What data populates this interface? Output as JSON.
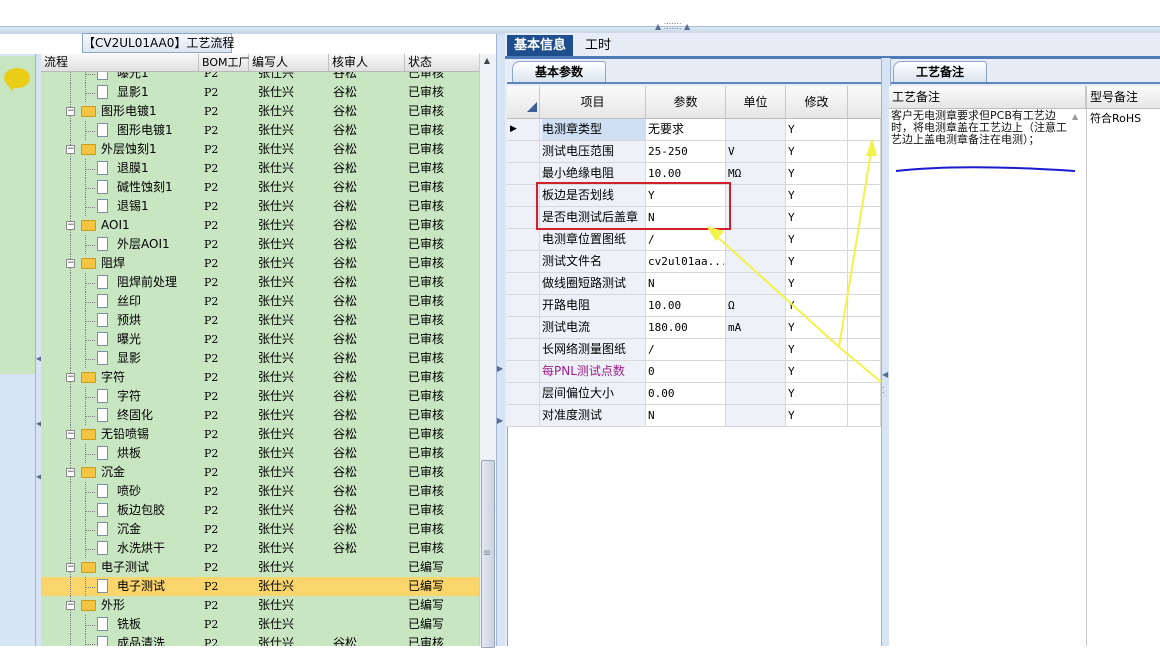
{
  "process_panel": {
    "title": "【CV2UL01AA0】工艺流程",
    "columns": [
      "流程",
      "BOM工厂",
      "编写人",
      "核审人",
      "状态"
    ],
    "rows": [
      {
        "name": "曝光1",
        "level": 2,
        "icon": "doc",
        "bom": "P2",
        "writer": "张仕兴",
        "reviewer": "谷松",
        "status": "已审核",
        "cut": true
      },
      {
        "name": "显影1",
        "level": 2,
        "icon": "doc",
        "bom": "P2",
        "writer": "张仕兴",
        "reviewer": "谷松",
        "status": "已审核"
      },
      {
        "name": "图形电镀1",
        "level": 1,
        "icon": "folder",
        "bom": "P2",
        "writer": "张仕兴",
        "reviewer": "谷松",
        "status": "已审核"
      },
      {
        "name": "图形电镀1",
        "level": 2,
        "icon": "doc",
        "bom": "P2",
        "writer": "张仕兴",
        "reviewer": "谷松",
        "status": "已审核"
      },
      {
        "name": "外层蚀刻1",
        "level": 1,
        "icon": "folder",
        "bom": "P2",
        "writer": "张仕兴",
        "reviewer": "谷松",
        "status": "已审核"
      },
      {
        "name": "退膜1",
        "level": 2,
        "icon": "doc",
        "bom": "P2",
        "writer": "张仕兴",
        "reviewer": "谷松",
        "status": "已审核"
      },
      {
        "name": "碱性蚀刻1",
        "level": 2,
        "icon": "doc",
        "bom": "P2",
        "writer": "张仕兴",
        "reviewer": "谷松",
        "status": "已审核"
      },
      {
        "name": "退锡1",
        "level": 2,
        "icon": "doc",
        "bom": "P2",
        "writer": "张仕兴",
        "reviewer": "谷松",
        "status": "已审核"
      },
      {
        "name": "AOI1",
        "level": 1,
        "icon": "folder",
        "bom": "P2",
        "writer": "张仕兴",
        "reviewer": "谷松",
        "status": "已审核"
      },
      {
        "name": "外层AOI1",
        "level": 2,
        "icon": "doc",
        "bom": "P2",
        "writer": "张仕兴",
        "reviewer": "谷松",
        "status": "已审核"
      },
      {
        "name": "阻焊",
        "level": 1,
        "icon": "folder",
        "bom": "P2",
        "writer": "张仕兴",
        "reviewer": "谷松",
        "status": "已审核"
      },
      {
        "name": "阻焊前处理",
        "level": 2,
        "icon": "doc",
        "bom": "P2",
        "writer": "张仕兴",
        "reviewer": "谷松",
        "status": "已审核"
      },
      {
        "name": "丝印",
        "level": 2,
        "icon": "doc",
        "bom": "P2",
        "writer": "张仕兴",
        "reviewer": "谷松",
        "status": "已审核"
      },
      {
        "name": "预烘",
        "level": 2,
        "icon": "doc",
        "bom": "P2",
        "writer": "张仕兴",
        "reviewer": "谷松",
        "status": "已审核"
      },
      {
        "name": "曝光",
        "level": 2,
        "icon": "doc",
        "bom": "P2",
        "writer": "张仕兴",
        "reviewer": "谷松",
        "status": "已审核"
      },
      {
        "name": "显影",
        "level": 2,
        "icon": "doc",
        "bom": "P2",
        "writer": "张仕兴",
        "reviewer": "谷松",
        "status": "已审核"
      },
      {
        "name": "字符",
        "level": 1,
        "icon": "folder",
        "bom": "P2",
        "writer": "张仕兴",
        "reviewer": "谷松",
        "status": "已审核"
      },
      {
        "name": "字符",
        "level": 2,
        "icon": "doc",
        "bom": "P2",
        "writer": "张仕兴",
        "reviewer": "谷松",
        "status": "已审核"
      },
      {
        "name": "终固化",
        "level": 2,
        "icon": "doc",
        "bom": "P2",
        "writer": "张仕兴",
        "reviewer": "谷松",
        "status": "已审核"
      },
      {
        "name": "无铅喷锡",
        "level": 1,
        "icon": "folder",
        "bom": "P2",
        "writer": "张仕兴",
        "reviewer": "谷松",
        "status": "已审核"
      },
      {
        "name": "烘板",
        "level": 2,
        "icon": "doc",
        "bom": "P2",
        "writer": "张仕兴",
        "reviewer": "谷松",
        "status": "已审核"
      },
      {
        "name": "沉金",
        "level": 1,
        "icon": "folder",
        "bom": "P2",
        "writer": "张仕兴",
        "reviewer": "谷松",
        "status": "已审核"
      },
      {
        "name": "喷砂",
        "level": 2,
        "icon": "doc",
        "bom": "P2",
        "writer": "张仕兴",
        "reviewer": "谷松",
        "status": "已审核"
      },
      {
        "name": "板边包胶",
        "level": 2,
        "icon": "doc",
        "bom": "P2",
        "writer": "张仕兴",
        "reviewer": "谷松",
        "status": "已审核"
      },
      {
        "name": "沉金",
        "level": 2,
        "icon": "doc",
        "bom": "P2",
        "writer": "张仕兴",
        "reviewer": "谷松",
        "status": "已审核"
      },
      {
        "name": "水洗烘干",
        "level": 2,
        "icon": "doc",
        "bom": "P2",
        "writer": "张仕兴",
        "reviewer": "谷松",
        "status": "已审核"
      },
      {
        "name": "电子测试",
        "level": 1,
        "icon": "folder",
        "bom": "P2",
        "writer": "张仕兴",
        "reviewer": "",
        "status": "已编写"
      },
      {
        "name": "电子测试",
        "level": 2,
        "icon": "doc",
        "bom": "P2",
        "writer": "张仕兴",
        "reviewer": "",
        "status": "已编写",
        "selected": true
      },
      {
        "name": "外形",
        "level": 1,
        "icon": "folder",
        "bom": "P2",
        "writer": "张仕兴",
        "reviewer": "",
        "status": "已编写"
      },
      {
        "name": "铣板",
        "level": 2,
        "icon": "doc",
        "bom": "P2",
        "writer": "张仕兴",
        "reviewer": "",
        "status": "已编写"
      },
      {
        "name": "成品清洗",
        "level": 2,
        "icon": "doc",
        "bom": "P2",
        "writer": "张仕兴",
        "reviewer": "谷松",
        "status": "已审核",
        "cut": true
      }
    ]
  },
  "tabs": {
    "basic_info": "基本信息",
    "work_hours": "工时"
  },
  "param_panel": {
    "tab": "基本参数",
    "columns": [
      "项目",
      "参数",
      "单位",
      "修改"
    ],
    "rows": [
      {
        "item": "电测章类型",
        "value": "无要求",
        "unit": "",
        "modify": "Y",
        "current": true
      },
      {
        "item": "测试电压范围",
        "value": "25-250",
        "unit": "V",
        "modify": "Y"
      },
      {
        "item": "最小绝缘电阻",
        "value": "10.00",
        "unit": "MΩ",
        "modify": "Y"
      },
      {
        "item": "板边是否划线",
        "value": "Y",
        "unit": "",
        "modify": "Y"
      },
      {
        "item": "是否电测试后盖章",
        "value": "N",
        "unit": "",
        "modify": "Y"
      },
      {
        "item": "电测章位置图纸",
        "value": "/",
        "unit": "",
        "modify": "Y"
      },
      {
        "item": "测试文件名",
        "value": "cv2ul01aa...",
        "unit": "",
        "modify": "Y"
      },
      {
        "item": "做线圈短路测试",
        "value": "N",
        "unit": "",
        "modify": "Y"
      },
      {
        "item": "开路电阻",
        "value": "10.00",
        "unit": "Ω",
        "modify": "Y"
      },
      {
        "item": "测试电流",
        "value": "180.00",
        "unit": "mA",
        "modify": "Y"
      },
      {
        "item": "长网络测量图纸",
        "value": "/",
        "unit": "",
        "modify": "Y"
      },
      {
        "item": "每PNL测试点数",
        "value": "0",
        "unit": "",
        "modify": "Y",
        "highlight": true
      },
      {
        "item": "层间偏位大小",
        "value": "0.00",
        "unit": "",
        "modify": "Y"
      },
      {
        "item": "对准度测试",
        "value": "N",
        "unit": "",
        "modify": "Y"
      }
    ]
  },
  "notes_panel": {
    "tab": "工艺备注",
    "columns": [
      "工艺备注",
      "型号备注"
    ],
    "process_note": "客户无电测章要求但PCB有工艺边时，将电测章盖在工艺边上（注意工艺边上盖电测章备注在电测）；",
    "model_note": "符合RoHS"
  },
  "colors": {
    "tree_bg": "#c9e6c2",
    "selected_row": "#fad56c",
    "accent_tab": "#1f4e8e",
    "annotation_box": "#d0202a",
    "annotation_arrow": "#f2f24a",
    "annotation_line": "#1a1ad0",
    "highlight_text": "#a0208f"
  }
}
